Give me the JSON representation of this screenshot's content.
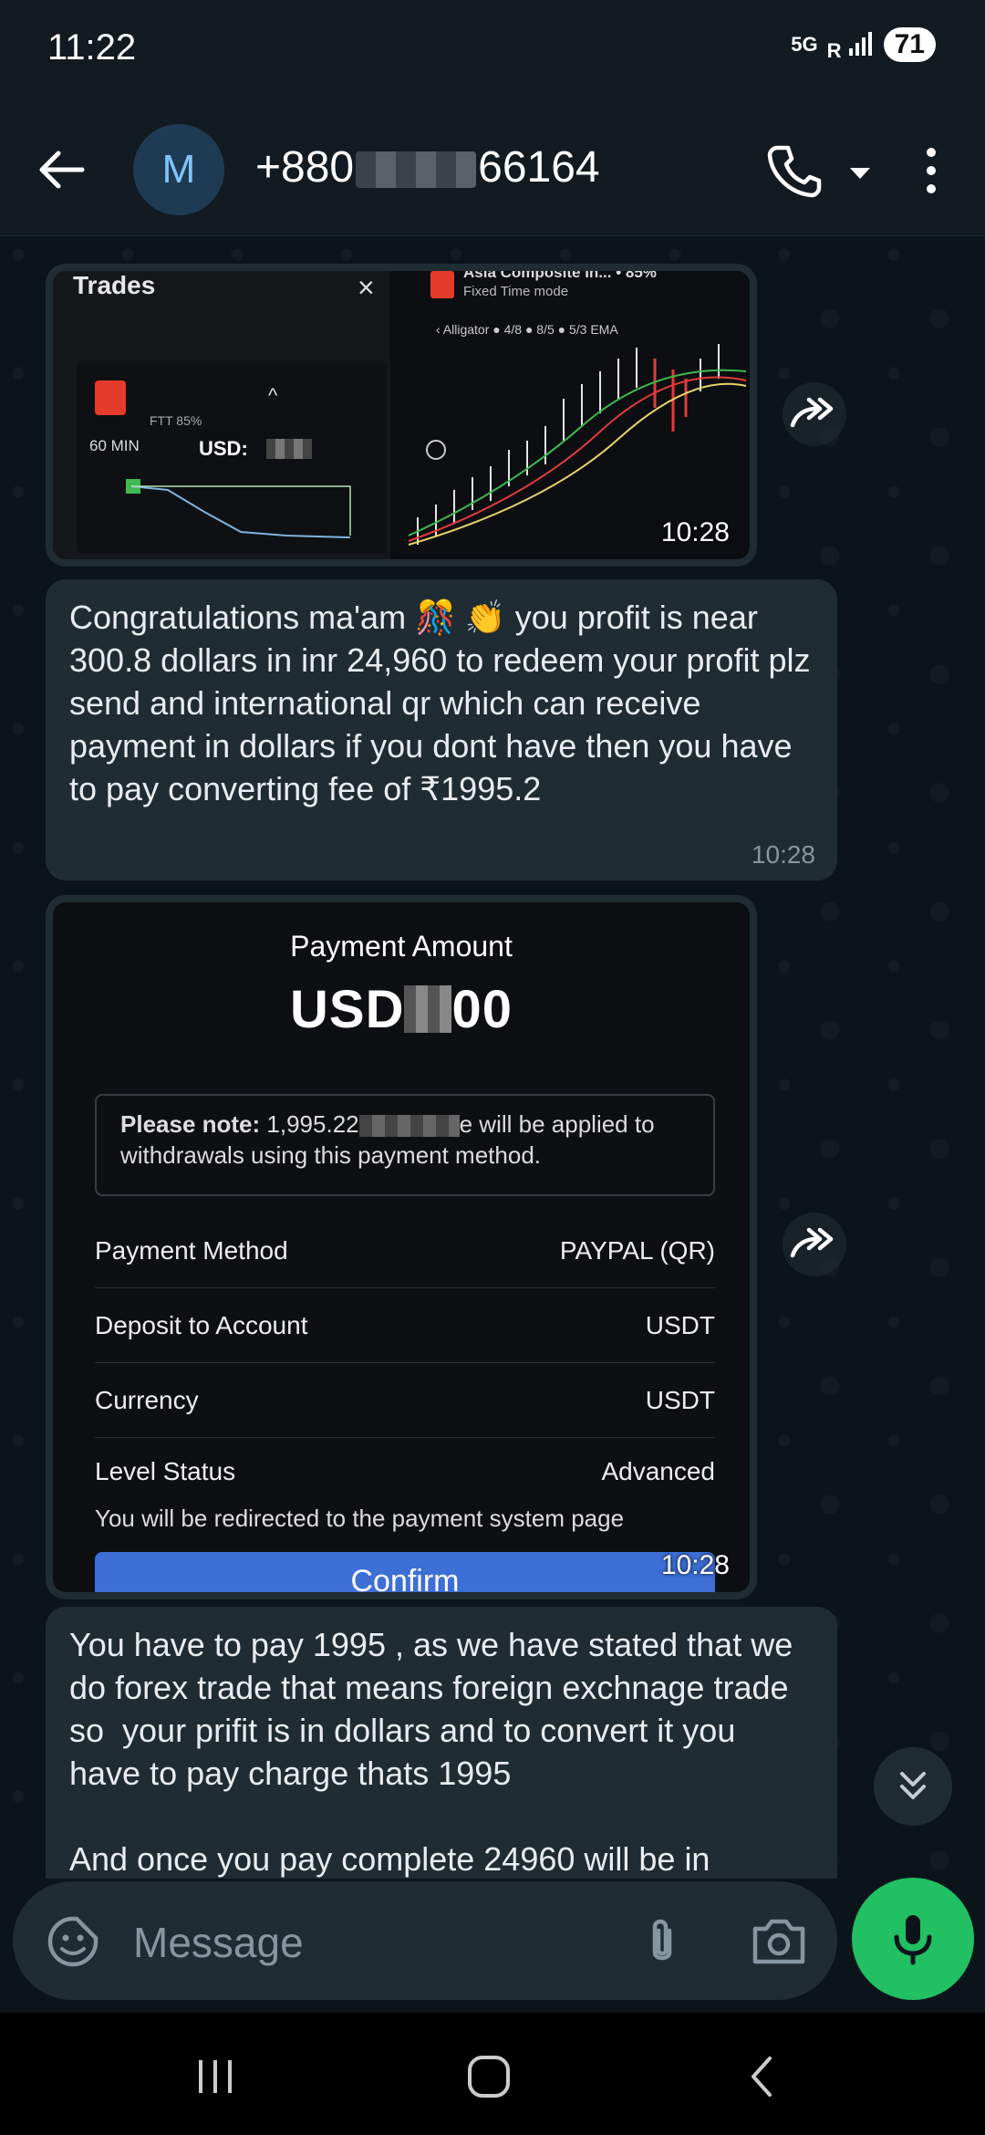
{
  "status_bar": {
    "time": "11:22",
    "network": "5G",
    "signal": "R",
    "battery": "71"
  },
  "header": {
    "avatar_letter": "M",
    "contact_prefix": "+880",
    "contact_suffix": "66164"
  },
  "messages": {
    "image1": {
      "trades_title": "Trades",
      "close": "×",
      "ftt": "FTT 85%",
      "min": "60 MIN",
      "usd": "USD:",
      "asia_title": "Asia Composite In... • 85%",
      "fixed_mode": "Fixed Time mode",
      "alligator": "‹  Alligator ● 4/8 ● 8/5 ● 5/3   EMA",
      "time": "10:28"
    },
    "text1": {
      "text": "Congratulations ma'am 🎊 👏 you profit is near 300.8 dollars in inr 24,960 to redeem your profit plz send and international qr which can receive payment in dollars if you dont have then you have to pay converting fee of ₹1995.2",
      "time": "10:28"
    },
    "image2": {
      "label": "Payment Amount",
      "amount_prefix": "USD",
      "amount_suffix": "00",
      "note_bold": "Please note:",
      "note_value": "1,995.22",
      "note_rest": "e will be applied to withdrawals using this payment method.",
      "rows": [
        {
          "label": "Payment Method",
          "value": "PAYPAL (QR)"
        },
        {
          "label": "Deposit to Account",
          "value": "USDT"
        },
        {
          "label": "Currency",
          "value": "USDT"
        },
        {
          "label": "Level Status",
          "value": "Advanced"
        }
      ],
      "redirect": "You will be redirected to the payment system page",
      "confirm": "Confirm",
      "time": "10:28"
    },
    "text2": {
      "text": "You have to pay 1995 , as we have stated that we do forex trade that means foreign exchnage trade so  your prifit is in dollars and to convert it you have to pay charge thats 1995\n\nAnd once you pay complete 24960 will be in"
    }
  },
  "input": {
    "placeholder": "Message"
  },
  "colors": {
    "accent": "#21c063",
    "bubble": "#1f2c34",
    "background": "#0b141a",
    "confirm": "#3d6fd6"
  },
  "icons": [
    "back-arrow-icon",
    "call-icon",
    "chevron-down-icon",
    "more-vert-icon",
    "forward-icon",
    "sticker-icon",
    "attach-icon",
    "camera-icon",
    "mic-icon",
    "double-chevron-down-icon",
    "recent-apps-icon",
    "home-icon",
    "nav-back-icon"
  ]
}
